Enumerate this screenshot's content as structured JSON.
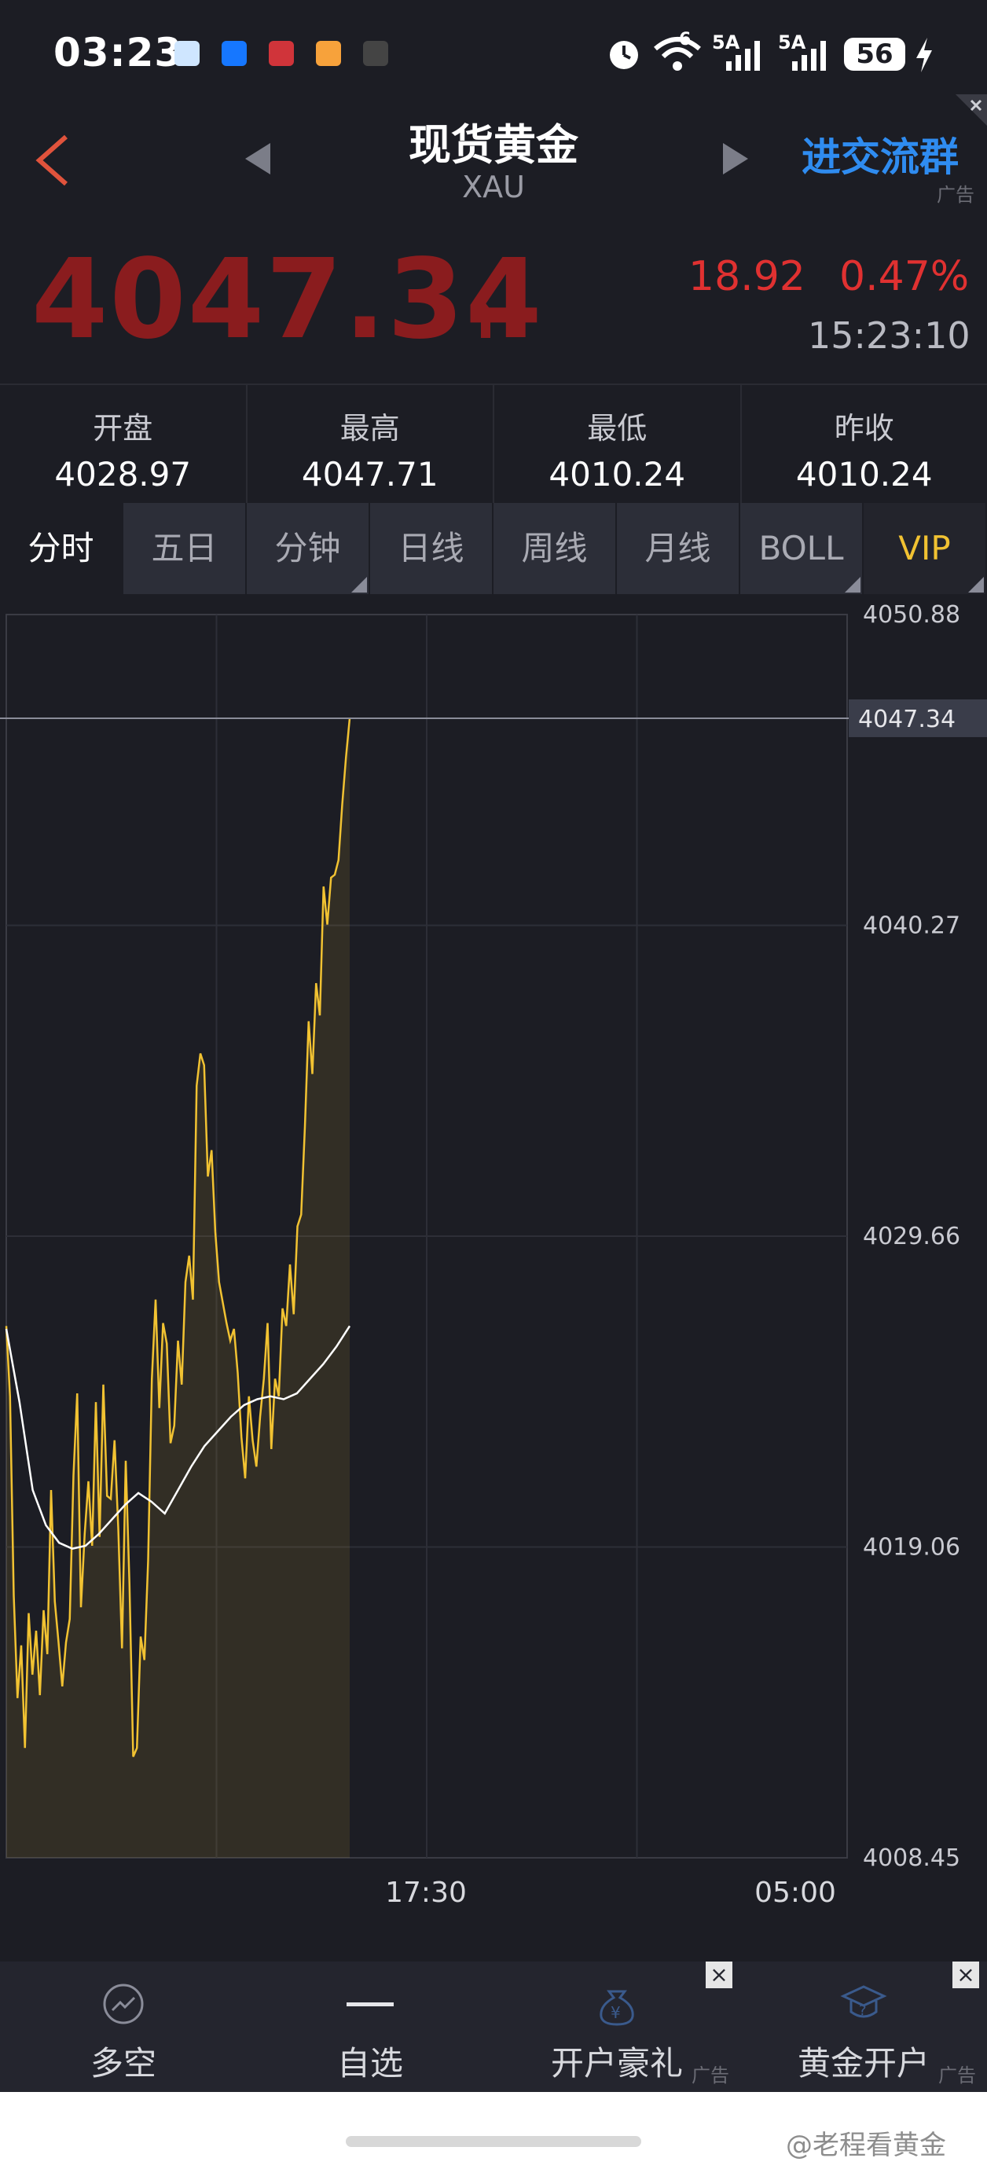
{
  "status_bar": {
    "time": "03:23",
    "network_a": "5A",
    "network_b": "5A",
    "wifi_badge": "6",
    "battery": "56"
  },
  "header": {
    "title": "现货黄金",
    "symbol": "XAU",
    "join_group": "进交流群",
    "ad_label": "广告"
  },
  "quote": {
    "price": "4047.34",
    "change": "18.92",
    "change_pct": "0.47%",
    "time": "15:23:10"
  },
  "stats": [
    {
      "label": "开盘",
      "value": "4028.97"
    },
    {
      "label": "最高",
      "value": "4047.71"
    },
    {
      "label": "最低",
      "value": "4010.24"
    },
    {
      "label": "昨收",
      "value": "4010.24"
    }
  ],
  "tabs": [
    "分时",
    "五日",
    "分钟",
    "日线",
    "周线",
    "月线",
    "BOLL",
    "VIP"
  ],
  "chart_data": {
    "type": "line",
    "y_ticks": [
      "4050.88",
      "4040.27",
      "4029.66",
      "4019.06",
      "4008.45"
    ],
    "ylim": [
      4008.45,
      4050.88
    ],
    "current_price_label": "4047.34",
    "x_ticks": [
      "17:30",
      "05:00"
    ],
    "series": [
      {
        "color": "#f1c232",
        "values": [
          4026.6,
          4024.2,
          4017.4,
          4013.9,
          4015.7,
          4012.2,
          4016.8,
          4014.7,
          4016.2,
          4014.0,
          4016.9,
          4015.4,
          4021.0,
          4017.2,
          4015.8,
          4014.3,
          4015.8,
          4016.6,
          4021.5,
          4024.3,
          4017.0,
          4019.5,
          4021.3,
          4019.1,
          4024.0,
          4019.4,
          4024.6,
          4020.8,
          4020.7,
          4022.7,
          4019.7,
          4015.6,
          4022.0,
          4017.8,
          4011.9,
          4012.2,
          4016.0,
          4015.2,
          4018.6,
          4024.8,
          4027.5,
          4023.8,
          4026.7,
          4026.0,
          4022.6,
          4023.2,
          4026.1,
          4024.6,
          4028.1,
          4029.0,
          4027.5,
          4034.8,
          4035.9,
          4035.5,
          4031.7,
          4032.6,
          4029.8,
          4028.1,
          4027.4,
          4026.7,
          4026.1,
          4026.5,
          4025.0,
          4022.8,
          4021.4,
          4024.2,
          4022.7,
          4021.8,
          4023.5,
          4024.8,
          4026.7,
          4022.4,
          4024.8,
          4024.2,
          4027.2,
          4026.6,
          4028.7,
          4027.0,
          4030.0,
          4030.4,
          4033.4,
          4037.0,
          4035.2,
          4038.3,
          4037.2,
          4041.6,
          4040.3,
          4041.9,
          4042.0,
          4042.5,
          4044.4,
          4046.0,
          4047.34
        ]
      },
      {
        "color": "#ffffff",
        "values": [
          4026.5,
          4024.0,
          4021.0,
          4019.8,
          4019.2,
          4019.0,
          4019.1,
          4019.5,
          4020.0,
          4020.5,
          4020.9,
          4020.6,
          4020.2,
          4021.0,
          4021.8,
          4022.5,
          4023.0,
          4023.5,
          4023.9,
          4024.1,
          4024.2,
          4024.1,
          4024.3,
          4024.8,
          4025.3,
          4025.9,
          4026.6
        ]
      }
    ]
  },
  "bottom_nav": [
    {
      "label": "多空",
      "ad": ""
    },
    {
      "label": "自选",
      "ad": ""
    },
    {
      "label": "开户豪礼",
      "ad": "广告"
    },
    {
      "label": "黄金开户",
      "ad": "广告"
    }
  ],
  "watermark": "@老程看黄金"
}
